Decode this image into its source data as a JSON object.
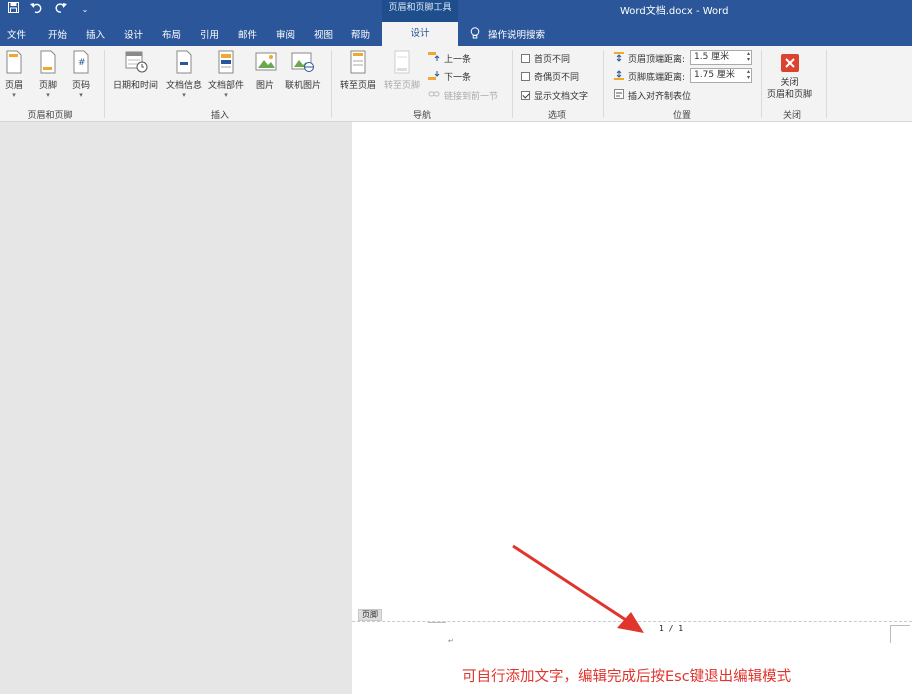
{
  "window": {
    "title": "Word文档.docx  -  Word",
    "context_tools_label": "页眉和页脚工具"
  },
  "qat": {
    "save": "save-icon",
    "undo": "undo-icon",
    "redo": "redo-icon",
    "customize": "customize-icon"
  },
  "tabs": [
    "文件",
    "开始",
    "插入",
    "设计",
    "布局",
    "引用",
    "邮件",
    "审阅",
    "视图",
    "帮助"
  ],
  "active_tab": "设计",
  "tell_me": "操作说明搜索",
  "ribbon": {
    "group_header_footer": {
      "label": "页眉和页脚",
      "buttons": [
        "页眉",
        "页脚",
        "页码"
      ]
    },
    "group_insert": {
      "label": "插入",
      "buttons": [
        "日期和时间",
        "文档信息",
        "文档部件",
        "图片",
        "联机图片"
      ]
    },
    "group_nav": {
      "label": "导航",
      "goto_header": "转至页眉",
      "goto_footer": "转至页脚",
      "prev": "上一条",
      "next": "下一条",
      "link_prev": "链接到前一节"
    },
    "group_options": {
      "label": "选项",
      "diff_first": "首页不同",
      "diff_odd_even": "奇偶页不同",
      "show_text": "显示文档文字",
      "diff_first_checked": false,
      "diff_odd_even_checked": false,
      "show_text_checked": true
    },
    "group_position": {
      "label": "位置",
      "header_top_label": "页眉顶端距离:",
      "header_top_value": "1.5 厘米",
      "footer_bottom_label": "页脚底端距离:",
      "footer_bottom_value": "1.75 厘米",
      "insert_align_tab": "插入对齐制表位"
    },
    "group_close": {
      "label": "关闭",
      "close_button": "关闭\n页眉和页脚"
    }
  },
  "document": {
    "footer_tag": "页脚",
    "page_number": "1 / 1",
    "para_mark": "↵",
    "annotation": "可自行添加文字，编辑完成后按Esc键退出编辑模式"
  },
  "colors": {
    "word_blue": "#2b579a",
    "annotation_red": "#e0342c",
    "close_red": "#d9432f"
  }
}
